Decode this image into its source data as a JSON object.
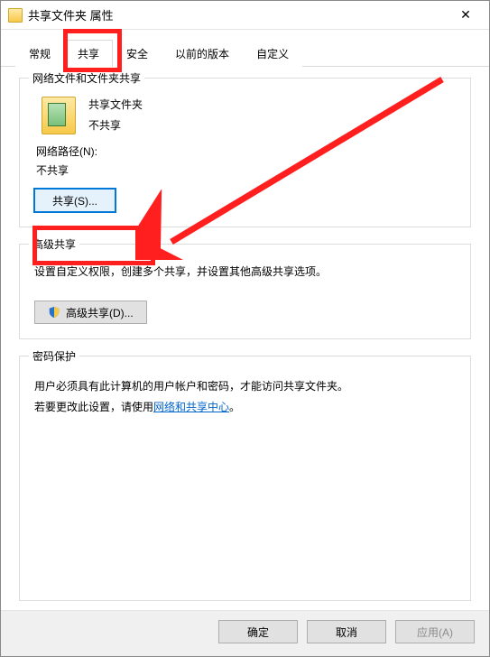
{
  "window": {
    "title": "共享文件夹 属性"
  },
  "tabs": {
    "general": "常规",
    "sharing": "共享",
    "security": "安全",
    "previous_versions": "以前的版本",
    "customize": "自定义"
  },
  "group_network": {
    "legend": "网络文件和文件夹共享",
    "item_name": "共享文件夹",
    "item_status": "不共享",
    "netpath_label": "网络路径(N):",
    "netpath_value": "不共享",
    "share_button": "共享(S)..."
  },
  "group_advanced": {
    "legend": "高级共享",
    "description": "设置自定义权限，创建多个共享，并设置其他高级共享选项。",
    "button": "高级共享(D)..."
  },
  "group_password": {
    "legend": "密码保护",
    "line1": "用户必须具有此计算机的用户帐户和密码，才能访问共享文件夹。",
    "line2_prefix": "若要更改此设置，请使用",
    "link": "网络和共享中心",
    "line2_suffix": "。"
  },
  "footer": {
    "ok": "确定",
    "cancel": "取消",
    "apply": "应用(A)"
  }
}
